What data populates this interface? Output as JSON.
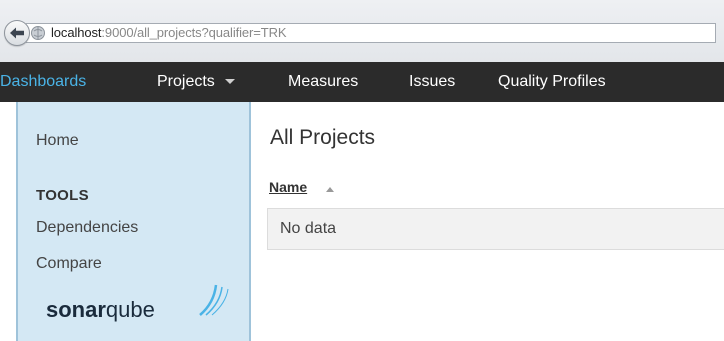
{
  "browser": {
    "url_host": "localhost",
    "url_rest": ":9000/all_projects?qualifier=TRK"
  },
  "nav": {
    "items": [
      {
        "label": "Dashboards",
        "active": true
      },
      {
        "label": "Projects",
        "dropdown": true
      },
      {
        "label": "Measures"
      },
      {
        "label": "Issues"
      },
      {
        "label": "Quality Profiles"
      }
    ]
  },
  "sidebar": {
    "home": "Home",
    "tools_heading": "TOOLS",
    "links": [
      "Dependencies",
      "Compare"
    ],
    "logo": {
      "bold": "sonar",
      "regular": "qube"
    }
  },
  "main": {
    "title": "All Projects",
    "column_header": "Name",
    "empty_message": "No data"
  },
  "colors": {
    "nav_bg": "#2b2b2b",
    "nav_active": "#4ab3e6",
    "sidebar_bg": "#d4e8f4",
    "logo_wave": "#4ab3e6"
  },
  "icons": [
    "back-arrow-icon",
    "site-identity-icon",
    "dropdown-caret-icon",
    "sort-ascending-icon",
    "sonarqube-wave-icon"
  ]
}
